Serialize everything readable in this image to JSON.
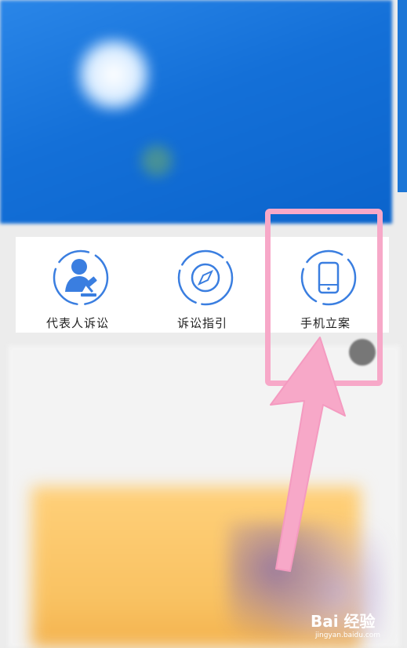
{
  "shortcuts": [
    {
      "label": "代表人诉讼",
      "icon": "representative-litigation-icon"
    },
    {
      "label": "诉讼指引",
      "icon": "compass-icon"
    },
    {
      "label": "手机立案",
      "icon": "mobile-phone-icon"
    }
  ],
  "watermark": {
    "main": "Bai 经验",
    "sub": "jingyan.baidu.com"
  },
  "colors": {
    "banner_blue": "#1470d8",
    "icon_blue": "#3a7ee0",
    "highlight_pink": "#f7a8c8"
  }
}
